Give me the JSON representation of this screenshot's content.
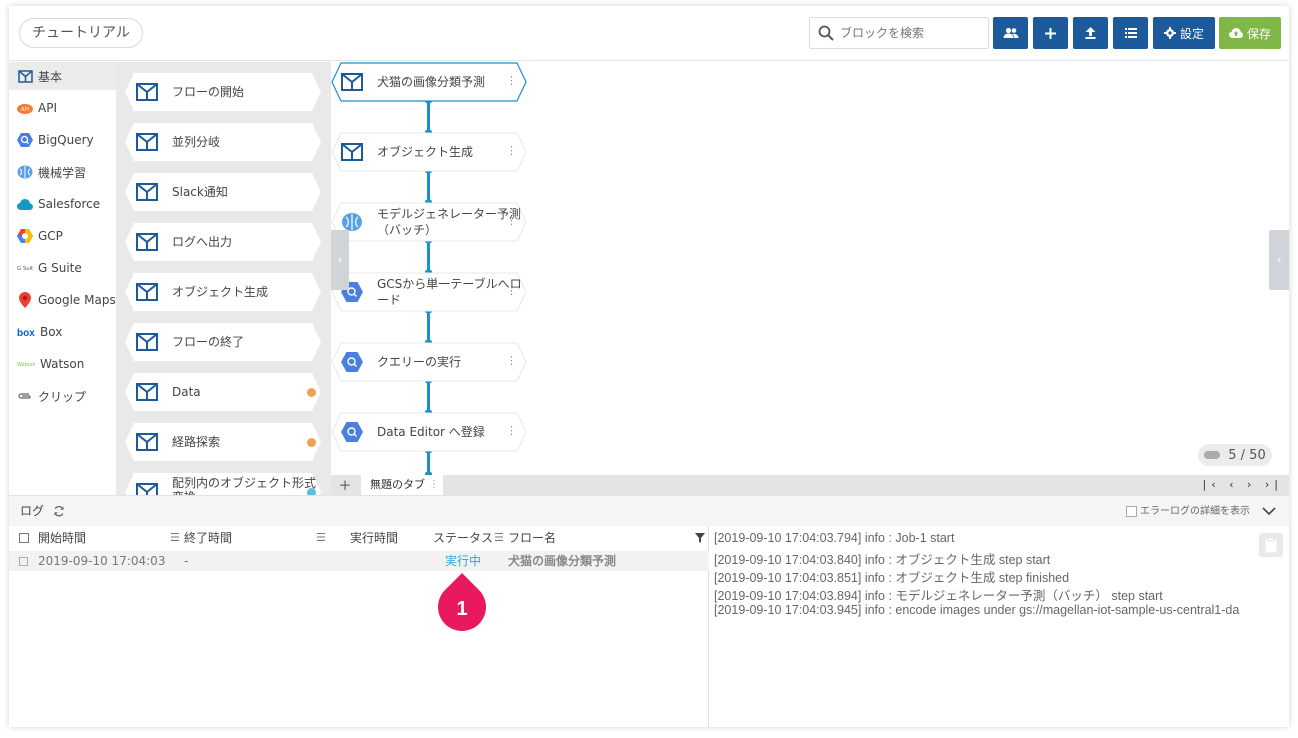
{
  "header": {
    "title": "チュートリアル",
    "search_placeholder": "ブロックを検索",
    "settings_label": "設定",
    "save_label": "保存"
  },
  "categories": [
    {
      "label": "基本",
      "icon": "basic-block-icon"
    },
    {
      "label": "API",
      "icon": "api-icon"
    },
    {
      "label": "BigQuery",
      "icon": "bigquery-icon"
    },
    {
      "label": "機械学習",
      "icon": "brain-icon"
    },
    {
      "label": "Salesforce",
      "icon": "cloud-icon"
    },
    {
      "label": "GCP",
      "icon": "gcp-icon"
    },
    {
      "label": "G Suite",
      "icon": "gsuite-icon"
    },
    {
      "label": "Google Maps",
      "icon": "map-pin-icon"
    },
    {
      "label": "Box",
      "icon": "box-icon"
    },
    {
      "label": "Watson",
      "icon": "watson-icon"
    },
    {
      "label": "クリップ",
      "icon": "clip-icon"
    }
  ],
  "palette": [
    {
      "label": "フローの開始"
    },
    {
      "label": "並列分岐"
    },
    {
      "label": "Slack通知"
    },
    {
      "label": "ログへ出力"
    },
    {
      "label": "オブジェクト生成"
    },
    {
      "label": "フローの終了"
    },
    {
      "label": "Data",
      "dot": "#f0a050"
    },
    {
      "label": "経路探索",
      "dot": "#f0a050"
    },
    {
      "label": "配列内のオブジェクト形式変換",
      "label_line1": "配列内のオブジェクト形式",
      "label_line2": "変換",
      "dot": "#5bc0de"
    }
  ],
  "flow": [
    {
      "label": "犬猫の画像分類予測",
      "icon": "basic-block-icon"
    },
    {
      "label": "オブジェクト生成",
      "icon": "basic-block-icon"
    },
    {
      "label_line1": "モデルジェネレーター予測",
      "label_line2": "（バッチ）",
      "icon": "brain-icon"
    },
    {
      "label_line1": "GCSから単一テーブルへロ",
      "label_line2": "ード",
      "icon": "bigquery-icon"
    },
    {
      "label": "クエリーの実行",
      "icon": "bigquery-icon"
    },
    {
      "label": "Data Editor へ登録",
      "icon": "bigquery-icon"
    }
  ],
  "canvas": {
    "page_indicator": "5 / 50",
    "tab_name": "無題のタブ",
    "tab_add": "+",
    "tab_nav": "|‹ ‹ › ›|"
  },
  "log": {
    "title": "ログ",
    "error_detail_label": "エラーログの詳細を表示",
    "columns": {
      "start": "開始時間",
      "end": "終了時間",
      "duration": "実行時間",
      "status": "ステータス",
      "flow": "フロー名"
    },
    "rows": [
      {
        "start": "2019-09-10 17:04:03",
        "end": "-",
        "duration": "",
        "status": "実行中",
        "flow": "犬猫の画像分類予測"
      }
    ],
    "badge": "1",
    "console": [
      "[2019-09-10 17:04:03.794]  info : Job-1 start",
      "[2019-09-10 17:04:03.840]  info : オブジェクト生成 step start",
      "[2019-09-10 17:04:03.851]  info : オブジェクト生成 step finished",
      "[2019-09-10 17:04:03.894]  info : モデルジェネレーター予測（バッチ） step start",
      "[2019-09-10 17:04:03.945]  info : encode images under gs://magellan-iot-sample-us-central1-da"
    ]
  },
  "colors": {
    "primary": "#1c5a9c",
    "save": "#7fb848",
    "connector": "#1a90d0",
    "badge": "#e8195c",
    "status_running": "#2aa7d8"
  }
}
